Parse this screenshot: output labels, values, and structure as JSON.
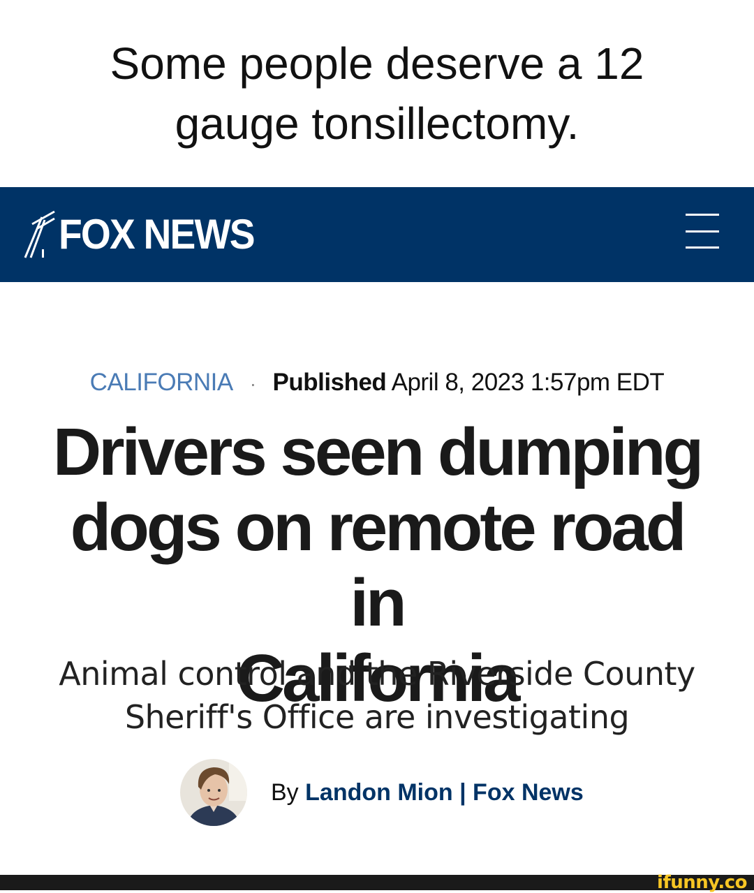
{
  "caption": {
    "line1": "Some people deserve a 12",
    "line2": "gauge tonsillectomy."
  },
  "header": {
    "brand": "FOX NEWS",
    "background_color": "#003366",
    "menu_icon": "hamburger-menu-icon"
  },
  "article": {
    "category": "CALIFORNIA",
    "separator": "·",
    "published_label": "Published",
    "published_date": "April 8, 2023 1:57pm EDT",
    "headline_line1": "Drivers seen dumping",
    "headline_line2": "dogs on remote road in",
    "headline_line3": "California",
    "subhead_line1": "Animal control and the Riverside County",
    "subhead_line2": "Sheriff's Office are investigating",
    "byline_prefix": "By",
    "author": "Landon Mion | Fox News"
  },
  "watermark": {
    "text": "ifunny.co",
    "color": "#f7c624"
  }
}
